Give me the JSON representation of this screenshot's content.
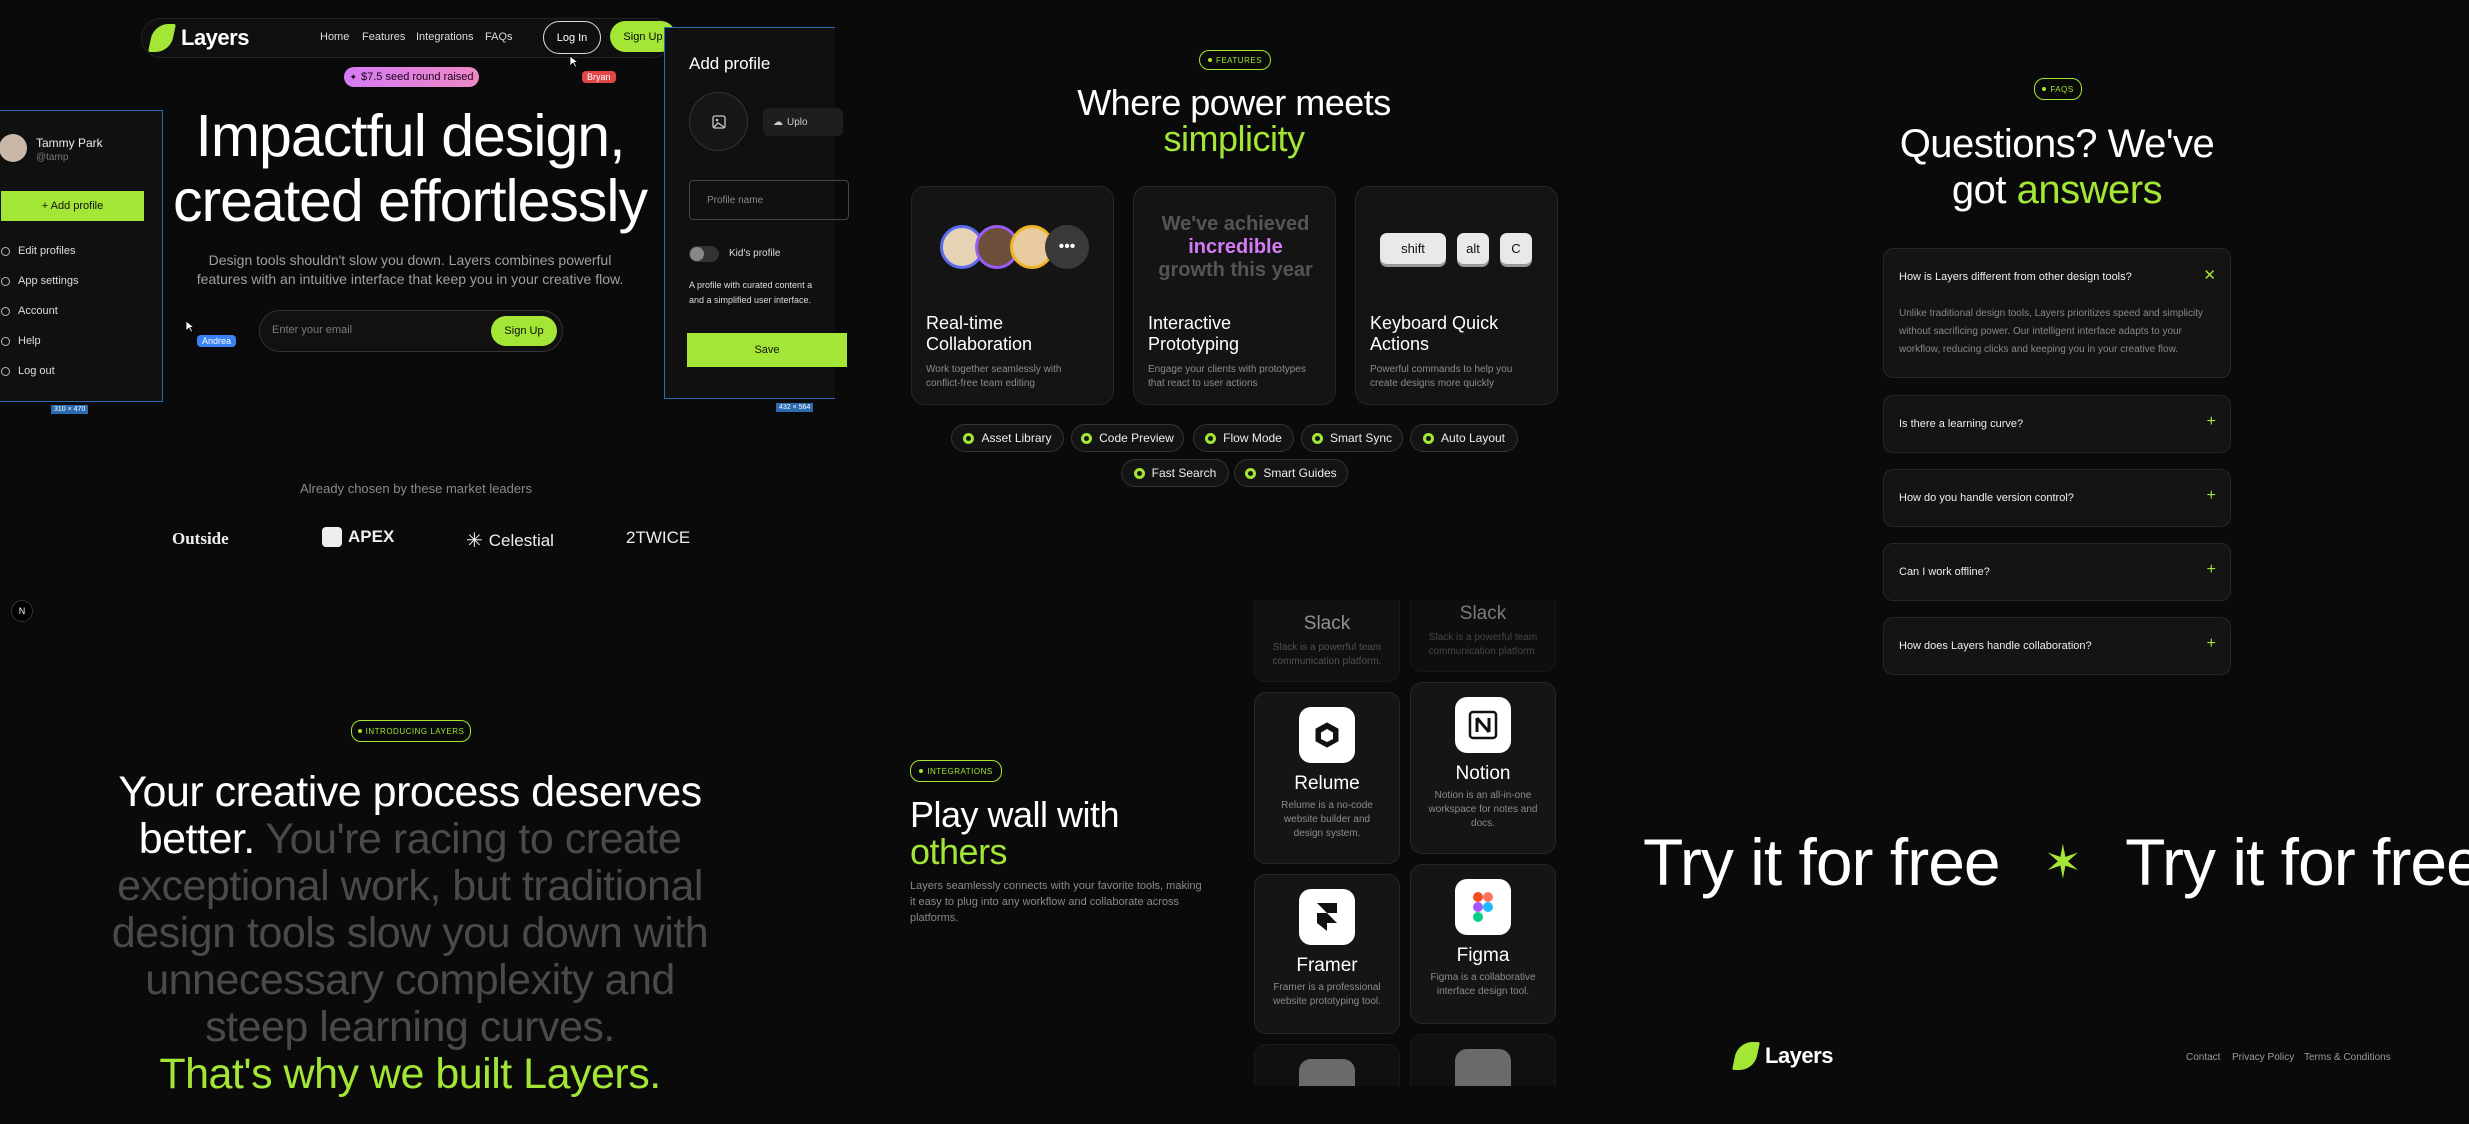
{
  "nav": {
    "brand": "Layers",
    "links": [
      "Home",
      "Features",
      "Integrations",
      "FAQs"
    ],
    "login": "Log In",
    "signup": "Sign Up"
  },
  "hero": {
    "badge": "$7.5 seed round raised",
    "title_line1": "Impactful design,",
    "title_line2": "created effortlessly",
    "subtitle_line1": "Design tools shouldn't slow you down. Layers combines powerful",
    "subtitle_line2": "features with an intuitive interface that keep you in your creative flow.",
    "email_placeholder": "Enter your email",
    "signup": "Sign Up",
    "cursor_bryan": "Bryan",
    "cursor_andrea": "Andrea"
  },
  "profile_menu": {
    "name": "Tammy Park",
    "handle": "@tamp",
    "add_profile": "+ Add profile",
    "items": [
      "Edit profiles",
      "App settings",
      "Account",
      "Help",
      "Log out"
    ],
    "size_label": "310 × 470"
  },
  "add_profile_panel": {
    "title": "Add profile",
    "upload": "Uplo",
    "profile_name_placeholder": "Profile name",
    "kids_profile": "Kid's profile",
    "desc_line1": "A profile with curated content a",
    "desc_line2": "and a simplified user interface.",
    "save": "Save",
    "size_label": "432 × 564"
  },
  "leaders": {
    "caption": "Already chosen by these market leaders",
    "brands": [
      "Outside",
      "APEX",
      "Celestial",
      "2TWICE"
    ]
  },
  "features": {
    "tag": "FEATURES",
    "title_line1": "Where power meets",
    "title_line2": "simplicity",
    "cards": [
      {
        "title_line1": "Real-time",
        "title_line2": "Collaboration",
        "desc_line1": "Work together seamlessly with",
        "desc_line2": "conflict-free team editing"
      },
      {
        "title_line1": "Interactive",
        "title_line2": "Prototyping",
        "desc_line1": "Engage your clients with prototypes",
        "desc_line2": "that react to user actions"
      },
      {
        "title_line1": "Keyboard Quick",
        "title_line2": "Actions",
        "desc_line1": "Powerful commands to help you",
        "desc_line2": "create designs more quickly"
      }
    ],
    "growth_line1": "We've achieved",
    "growth_line2": "incredible",
    "growth_line3": "growth this year",
    "keys": [
      "shift",
      "alt",
      "C"
    ],
    "chips_row1": [
      "Asset Library",
      "Code Preview",
      "Flow Mode",
      "Smart Sync",
      "Auto Layout"
    ],
    "chips_row2": [
      "Fast Search",
      "Smart Guides"
    ]
  },
  "faq": {
    "tag": "FAQS",
    "title_line1": "Questions? We've",
    "title_line2a": "got ",
    "title_line2b": "answers",
    "open_question": "How is Layers different from other design tools?",
    "open_answer_line1": "Unlike traditional design tools, Layers prioritizes speed and simplicity",
    "open_answer_line2": "without sacrificing power. Our intelligent interface adapts to your",
    "open_answer_line3": "workflow, reducing clicks and keeping you in your creative flow.",
    "questions": [
      "Is there a learning curve?",
      "How do you handle version control?",
      "Can I work offline?",
      "How does Layers handle collaboration?"
    ]
  },
  "introducing": {
    "tag": "INTRODUCING LAYERS",
    "line1": "Your creative process deserves",
    "line2a": "better.",
    "line2b": " You're racing to create",
    "line3": "exceptional work, but traditional",
    "line4": "design tools slow you down with",
    "line5": "unnecessary complexity and",
    "line6": "steep learning curves.",
    "line7": "That's why we built Layers."
  },
  "integrations": {
    "tag": "INTEGRATIONS",
    "title_line1": "Play wall with",
    "title_line2": "others",
    "desc_line1": "Layers seamlessly connects with your favorite tools, making",
    "desc_line2": "it easy to plug into any workflow and collaborate across",
    "desc_line3": "platforms.",
    "slack_name": "Slack",
    "slack_desc_line1": "Slack is a powerful team",
    "slack_desc_line2": "communication platform.",
    "relume_name": "Relume",
    "relume_desc_line1": "Relume is a no-code",
    "relume_desc_line2": "website builder and",
    "relume_desc_line3": "design system.",
    "notion_name": "Notion",
    "notion_desc_line1": "Notion is an all-in-one",
    "notion_desc_line2": "workspace for notes and",
    "notion_desc_line3": "docs.",
    "framer_name": "Framer",
    "framer_desc_line1": "Framer is a professional",
    "framer_desc_line2": "website prototyping tool.",
    "figma_name": "Figma",
    "figma_desc_line1": "Figma is a collaborative",
    "figma_desc_line2": "interface design tool."
  },
  "cta": {
    "marquee_text": "Try it for free"
  },
  "footer": {
    "brand": "Layers",
    "links": [
      "Contact",
      "Privacy Policy",
      "Terms & Conditions"
    ]
  },
  "misc": {
    "n_badge": "N"
  },
  "colors": {
    "accent": "#a3e635",
    "background": "#0a0a0a",
    "selection": "#2b6cb0"
  }
}
